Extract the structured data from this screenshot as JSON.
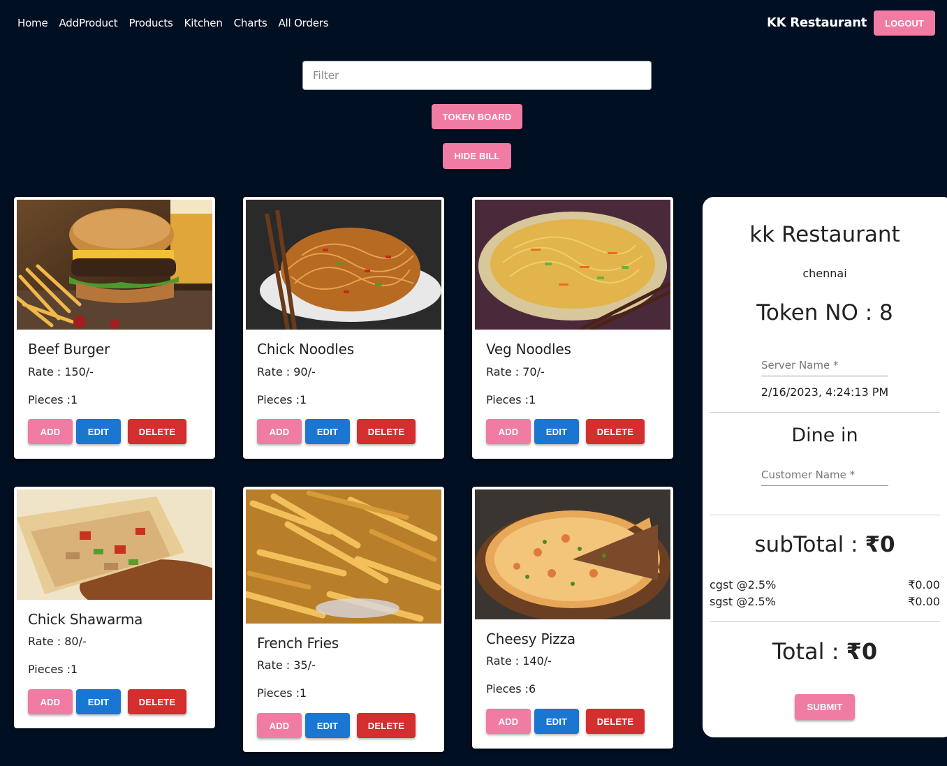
{
  "nav": {
    "links": [
      "Home",
      "AddProduct",
      "Products",
      "Kitchen",
      "Charts",
      "All Orders"
    ],
    "brand": "KK Restaurant",
    "logout_label": "LOGOUT"
  },
  "filter": {
    "placeholder": "Filter"
  },
  "actions": {
    "token_board_label": "TOKEN BOARD",
    "hide_bill_label": "HIDE BILL"
  },
  "buttons": {
    "add": "ADD",
    "edit": "EDIT",
    "delete": "DELETE"
  },
  "products": [
    {
      "name": "Beef Burger",
      "rate": "Rate : 150/-",
      "pieces": "Pieces :1",
      "image": "burger-image"
    },
    {
      "name": "Chick Noodles",
      "rate": "Rate : 90/-",
      "pieces": "Pieces :1",
      "image": "noodles-image"
    },
    {
      "name": "Veg Noodles",
      "rate": "Rate : 70/-",
      "pieces": "Pieces :1",
      "image": "veg-noodles-image"
    },
    {
      "name": "Chick Shawarma",
      "rate": "Rate : 80/-",
      "pieces": "Pieces :1",
      "image": "shawarma-image"
    },
    {
      "name": "French Fries",
      "rate": "Rate : 35/-",
      "pieces": "Pieces :1",
      "image": "fries-image"
    },
    {
      "name": "Cheesy Pizza",
      "rate": "Rate : 140/-",
      "pieces": "Pieces :6",
      "image": "pizza-image"
    }
  ],
  "bill": {
    "title": "kk Restaurant",
    "city": "chennai",
    "token": "Token NO : 8",
    "server_placeholder": "Server Name *",
    "datetime": "2/16/2023, 4:24:13 PM",
    "order_type": "Dine in",
    "customer_placeholder": "Customer Name *",
    "subtotal_label": "subTotal : ",
    "subtotal_value": "₹0",
    "cgst_label": "cgst @2.5%",
    "cgst_value": "₹0.00",
    "sgst_label": "sgst @2.5%",
    "sgst_value": "₹0.00",
    "total_label": "Total : ",
    "total_value": "₹0",
    "submit_label": "SUBMIT"
  },
  "colors": {
    "background": "#010f22",
    "accent_pink": "#f07ca3",
    "edit_blue": "#1b76d2",
    "delete_red": "#d32f2f"
  }
}
